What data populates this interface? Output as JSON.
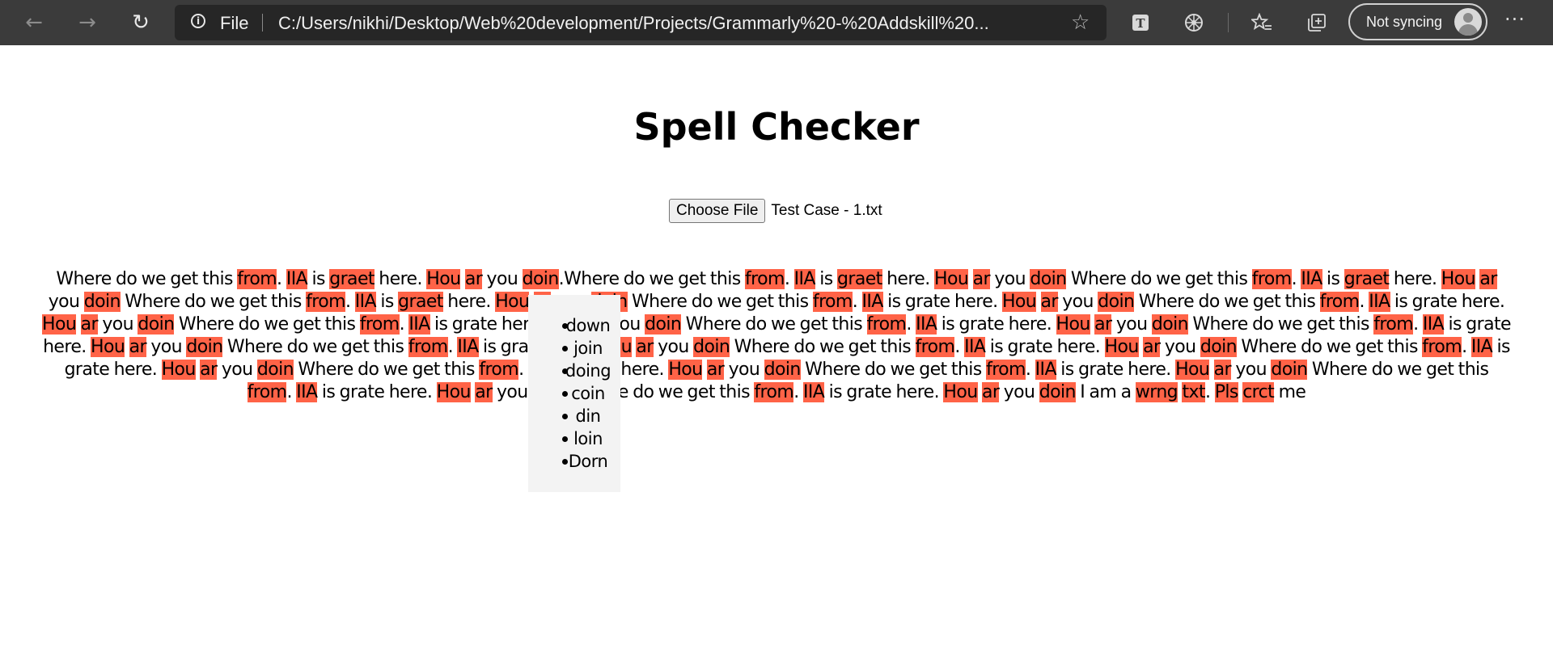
{
  "browser": {
    "address_scheme": "File",
    "url": "C:/Users/nikhi/Desktop/Web%20development/Projects/Grammarly%20-%20Addskill%20...",
    "sync_label": "Not syncing",
    "icons": [
      "back-arrow-icon",
      "forward-arrow-icon",
      "refresh-icon",
      "info-icon",
      "star-icon",
      "reading-icon",
      "extension-icon",
      "favorites-icon",
      "collections-icon",
      "avatar",
      "more-icon"
    ]
  },
  "page": {
    "title": "Spell Checker",
    "file_button_label": "Choose File",
    "file_name": "Test Case - 1.txt"
  },
  "highlight_color": "#ff6347",
  "text_segments": [
    {
      "t": "Where do we get this ",
      "e": false
    },
    {
      "t": "from",
      "e": true
    },
    {
      "t": ". ",
      "e": false
    },
    {
      "t": "IIA",
      "e": true
    },
    {
      "t": " is ",
      "e": false
    },
    {
      "t": "graet",
      "e": true
    },
    {
      "t": " here. ",
      "e": false
    },
    {
      "t": "Hou",
      "e": true
    },
    {
      "t": " ",
      "e": false
    },
    {
      "t": "ar",
      "e": true
    },
    {
      "t": " you ",
      "e": false
    },
    {
      "t": "doin",
      "e": true
    },
    {
      "t": ".",
      "e": false
    },
    {
      "t": "Where do we get this ",
      "e": false
    },
    {
      "t": "from",
      "e": true
    },
    {
      "t": ". ",
      "e": false
    },
    {
      "t": "IIA",
      "e": true
    },
    {
      "t": " is ",
      "e": false
    },
    {
      "t": "graet",
      "e": true
    },
    {
      "t": " here. ",
      "e": false
    },
    {
      "t": "Hou",
      "e": true
    },
    {
      "t": " ",
      "e": false
    },
    {
      "t": "ar",
      "e": true
    },
    {
      "t": " you ",
      "e": false
    },
    {
      "t": "doin",
      "e": true
    },
    {
      "t": " ",
      "e": false
    },
    {
      "t": "Where do we get this ",
      "e": false
    },
    {
      "t": "from",
      "e": true
    },
    {
      "t": ". ",
      "e": false
    },
    {
      "t": "IIA",
      "e": true
    },
    {
      "t": " is ",
      "e": false
    },
    {
      "t": "graet",
      "e": true
    },
    {
      "t": " here. ",
      "e": false
    },
    {
      "t": "Hou",
      "e": true
    },
    {
      "t": " ",
      "e": false
    },
    {
      "t": "ar",
      "e": true
    },
    {
      "t": " you ",
      "e": false
    },
    {
      "t": "doin",
      "e": true
    },
    {
      "t": " ",
      "e": false
    },
    {
      "t": "Where do we get this ",
      "e": false
    },
    {
      "t": "from",
      "e": true
    },
    {
      "t": ". ",
      "e": false
    },
    {
      "t": "IIA",
      "e": true
    },
    {
      "t": " is ",
      "e": false
    },
    {
      "t": "graet",
      "e": true
    },
    {
      "t": " here. ",
      "e": false
    },
    {
      "t": "Hou",
      "e": true
    },
    {
      "t": " ",
      "e": false
    },
    {
      "t": "ar",
      "e": true
    },
    {
      "t": " you ",
      "e": false
    },
    {
      "t": "doin",
      "e": true
    },
    {
      "t": " ",
      "e": false
    },
    {
      "t": "Where do we get this ",
      "e": false
    },
    {
      "t": "from",
      "e": true
    },
    {
      "t": ". ",
      "e": false
    },
    {
      "t": "IIA",
      "e": true
    },
    {
      "t": " is grate here. ",
      "e": false
    },
    {
      "t": "Hou",
      "e": true
    },
    {
      "t": " ",
      "e": false
    },
    {
      "t": "ar",
      "e": true
    },
    {
      "t": " you ",
      "e": false
    },
    {
      "t": "doin",
      "e": true
    },
    {
      "t": " ",
      "e": false
    },
    {
      "t": "Where do we get this ",
      "e": false
    },
    {
      "t": "from",
      "e": true
    },
    {
      "t": ". ",
      "e": false
    },
    {
      "t": "IIA",
      "e": true
    },
    {
      "t": " is grate here. ",
      "e": false
    },
    {
      "t": "Hou",
      "e": true
    },
    {
      "t": " ",
      "e": false
    },
    {
      "t": "ar",
      "e": true
    },
    {
      "t": " you ",
      "e": false
    },
    {
      "t": "doin",
      "e": true
    },
    {
      "t": " ",
      "e": false
    },
    {
      "t": "Where do we get this ",
      "e": false
    },
    {
      "t": "from",
      "e": true
    },
    {
      "t": ". ",
      "e": false
    },
    {
      "t": "IIA",
      "e": true
    },
    {
      "t": " is grate here. ",
      "e": false
    },
    {
      "t": "Hou",
      "e": true
    },
    {
      "t": " ",
      "e": false
    },
    {
      "t": "ar",
      "e": true
    },
    {
      "t": " you ",
      "e": false
    },
    {
      "t": "doin",
      "e": true
    },
    {
      "t": " ",
      "e": false
    },
    {
      "t": "Where do we get this ",
      "e": false
    },
    {
      "t": "from",
      "e": true
    },
    {
      "t": ". ",
      "e": false
    },
    {
      "t": "IIA",
      "e": true
    },
    {
      "t": " is grate here. ",
      "e": false
    },
    {
      "t": "Hou",
      "e": true
    },
    {
      "t": " ",
      "e": false
    },
    {
      "t": "ar",
      "e": true
    },
    {
      "t": " you ",
      "e": false
    },
    {
      "t": "doin",
      "e": true
    },
    {
      "t": " ",
      "e": false
    },
    {
      "t": "Where do we get this ",
      "e": false
    },
    {
      "t": "from",
      "e": true
    },
    {
      "t": ". ",
      "e": false
    },
    {
      "t": "IIA",
      "e": true
    },
    {
      "t": " is grate here. ",
      "e": false
    },
    {
      "t": "Hou",
      "e": true
    },
    {
      "t": " ",
      "e": false
    },
    {
      "t": "ar",
      "e": true
    },
    {
      "t": " you ",
      "e": false
    },
    {
      "t": "doin",
      "e": true
    },
    {
      "t": " ",
      "e": false
    },
    {
      "t": "Where do we get this ",
      "e": false
    },
    {
      "t": "from",
      "e": true
    },
    {
      "t": ". ",
      "e": false
    },
    {
      "t": "IIA",
      "e": true
    },
    {
      "t": " is grate here. ",
      "e": false
    },
    {
      "t": "Hou",
      "e": true
    },
    {
      "t": " ",
      "e": false
    },
    {
      "t": "ar",
      "e": true
    },
    {
      "t": " you ",
      "e": false
    },
    {
      "t": "doin",
      "e": true
    },
    {
      "t": " ",
      "e": false
    },
    {
      "t": "Where do we get this ",
      "e": false
    },
    {
      "t": "from",
      "e": true
    },
    {
      "t": ". ",
      "e": false
    },
    {
      "t": "IIA",
      "e": true
    },
    {
      "t": " is grate here. ",
      "e": false
    },
    {
      "t": "Hou",
      "e": true
    },
    {
      "t": " ",
      "e": false
    },
    {
      "t": "ar",
      "e": true
    },
    {
      "t": " you ",
      "e": false
    },
    {
      "t": "doin",
      "e": true
    },
    {
      "t": " ",
      "e": false
    },
    {
      "t": "Where do we get this ",
      "e": false
    },
    {
      "t": "from",
      "e": true
    },
    {
      "t": ". ",
      "e": false
    },
    {
      "t": "IIA",
      "e": true
    },
    {
      "t": " is grate here. ",
      "e": false
    },
    {
      "t": "Hou",
      "e": true
    },
    {
      "t": " ",
      "e": false
    },
    {
      "t": "ar",
      "e": true
    },
    {
      "t": " you ",
      "e": false
    },
    {
      "t": "doin",
      "e": true
    },
    {
      "t": " ",
      "e": false
    },
    {
      "t": "Where do we get this ",
      "e": false
    },
    {
      "t": "from",
      "e": true
    },
    {
      "t": ". ",
      "e": false
    },
    {
      "t": "IIA",
      "e": true
    },
    {
      "t": " is grate here. ",
      "e": false
    },
    {
      "t": "Hou",
      "e": true
    },
    {
      "t": " ",
      "e": false
    },
    {
      "t": "ar",
      "e": true
    },
    {
      "t": " you ",
      "e": false
    },
    {
      "t": "doin",
      "e": true
    },
    {
      "t": " ",
      "e": false
    },
    {
      "t": "Where do we get this ",
      "e": false
    },
    {
      "t": "from",
      "e": true
    },
    {
      "t": ". ",
      "e": false
    },
    {
      "t": "IIA",
      "e": true
    },
    {
      "t": " is grate here. ",
      "e": false
    },
    {
      "t": "Hou",
      "e": true
    },
    {
      "t": " ",
      "e": false
    },
    {
      "t": "ar",
      "e": true
    },
    {
      "t": " you ",
      "e": false
    },
    {
      "t": "doin",
      "e": true
    },
    {
      "t": " ",
      "e": false
    },
    {
      "t": "Where do we get this ",
      "e": false
    },
    {
      "t": "from",
      "e": true
    },
    {
      "t": ". ",
      "e": false
    },
    {
      "t": "IIA",
      "e": true
    },
    {
      "t": " is grate here. ",
      "e": false
    },
    {
      "t": "Hou",
      "e": true
    },
    {
      "t": " ",
      "e": false
    },
    {
      "t": "ar",
      "e": true
    },
    {
      "t": " you ",
      "e": false
    },
    {
      "t": "doin",
      "e": true
    },
    {
      "t": " ",
      "e": false
    },
    {
      "t": "Where do we get this ",
      "e": false
    },
    {
      "t": "from",
      "e": true
    },
    {
      "t": ". ",
      "e": false
    },
    {
      "t": "IIA",
      "e": true
    },
    {
      "t": " is grate here. ",
      "e": false
    },
    {
      "t": "Hou",
      "e": true
    },
    {
      "t": " ",
      "e": false
    },
    {
      "t": "ar",
      "e": true
    },
    {
      "t": " you ",
      "e": false
    },
    {
      "t": "doin",
      "e": true
    },
    {
      "t": " I am a ",
      "e": false
    },
    {
      "t": "wrng",
      "e": true
    },
    {
      "t": " ",
      "e": false
    },
    {
      "t": "txt",
      "e": true
    },
    {
      "t": ". ",
      "e": false
    },
    {
      "t": "Pls",
      "e": true
    },
    {
      "t": " ",
      "e": false
    },
    {
      "t": "crct",
      "e": true
    },
    {
      "t": " me",
      "e": false
    }
  ],
  "suggestions": [
    "down",
    "join",
    "doing",
    "coin",
    "din",
    "loin",
    "Dorn"
  ]
}
